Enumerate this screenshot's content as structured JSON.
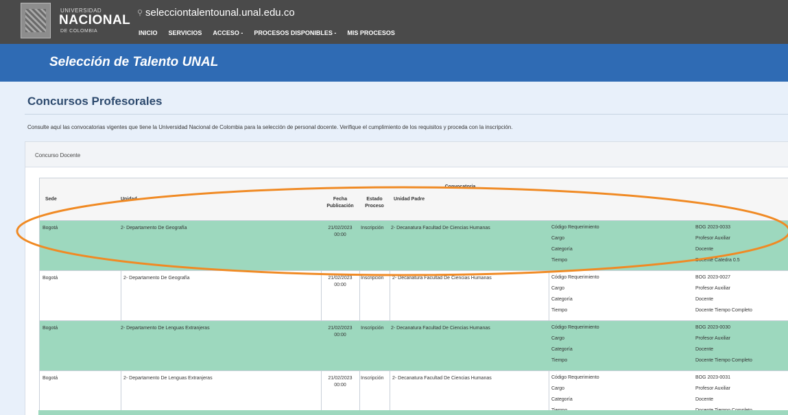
{
  "header": {
    "uni_small": "UNIVERSIDAD",
    "uni_big": "NACIONAL",
    "uni_sub": "DE COLOMBIA",
    "domain": "selecciontalentounal.unal.edu.co",
    "nav": [
      "INICIO",
      "SERVICIOS",
      "ACCESO -",
      "PROCESOS DISPONIBLES -",
      "MIS PROCESOS"
    ]
  },
  "banner": {
    "title": "Selección de Talento UNAL"
  },
  "page": {
    "heading": "Concursos Profesorales",
    "intro": "Consulte aquí las convocatorias vigentes que tiene la Universidad Nacional de Colombia para la selección de personal docente. Verifique el cumplimiento de los requisitos y proceda con la inscripción."
  },
  "panel": {
    "title": "Concurso Docente"
  },
  "table": {
    "group_header": "Convocatoria",
    "headers": {
      "sede": "Sede",
      "unidad": "Unidad",
      "fecha": "Fecha Publicación",
      "estado": "Estado Proceso",
      "unidad_padre": "Unidad Padre"
    },
    "rows": [
      {
        "sede": "Bogotá",
        "unidad": "2- Departamento De Geografía",
        "fecha": "21/02/2023 00:00",
        "estado": "Inscripción",
        "unidad_padre": "2- Decanatura Facultad De Ciencias Humanas",
        "labels": [
          "Código Requerimiento",
          "Cargo",
          "Categoría",
          "Tiempo"
        ],
        "values": [
          "BOG 2023-0033",
          "Profesor Auxiliar",
          "Docente",
          "Docente Catedra 0.5"
        ]
      },
      {
        "sede": "Bogotá",
        "unidad": "2- Departamento De Geografía",
        "fecha": "21/02/2023 00:00",
        "estado": "Inscripción",
        "unidad_padre": "2- Decanatura Facultad De Ciencias Humanas",
        "labels": [
          "Código Requerimiento",
          "Cargo",
          "Categoría",
          "Tiempo"
        ],
        "values": [
          "BOG 2023-0027",
          "Profesor Auxiliar",
          "Docente",
          "Docente Tiempo Completo"
        ]
      },
      {
        "sede": "Bogotá",
        "unidad": "2- Departamento De Lenguas Extranjeras",
        "fecha": "21/02/2023 00:00",
        "estado": "Inscripción",
        "unidad_padre": "2- Decanatura Facultad De Ciencias Humanas",
        "labels": [
          "Código Requerimiento",
          "Cargo",
          "Categoría",
          "Tiempo"
        ],
        "values": [
          "BOG 2023-0030",
          "Profesor Auxiliar",
          "Docente",
          "Docente Tiempo Completo"
        ]
      },
      {
        "sede": "Bogotá",
        "unidad": "2- Departamento De Lenguas Extranjeras",
        "fecha": "21/02/2023 00:00",
        "estado": "Inscripción",
        "unidad_padre": "2- Decanatura Facultad De Ciencias Humanas",
        "labels": [
          "Código Requerimiento",
          "Cargo",
          "Categoría",
          "Tiempo"
        ],
        "values": [
          "BOG 2023-0031",
          "Profesor Auxiliar",
          "Docente",
          "Docente Tiempo Completo"
        ]
      }
    ]
  },
  "colors": {
    "header_bg": "#4a4a4a",
    "banner_bg": "#2f6bb4",
    "row_highlight": "#9dd8be",
    "annotation": "#f08a24"
  }
}
